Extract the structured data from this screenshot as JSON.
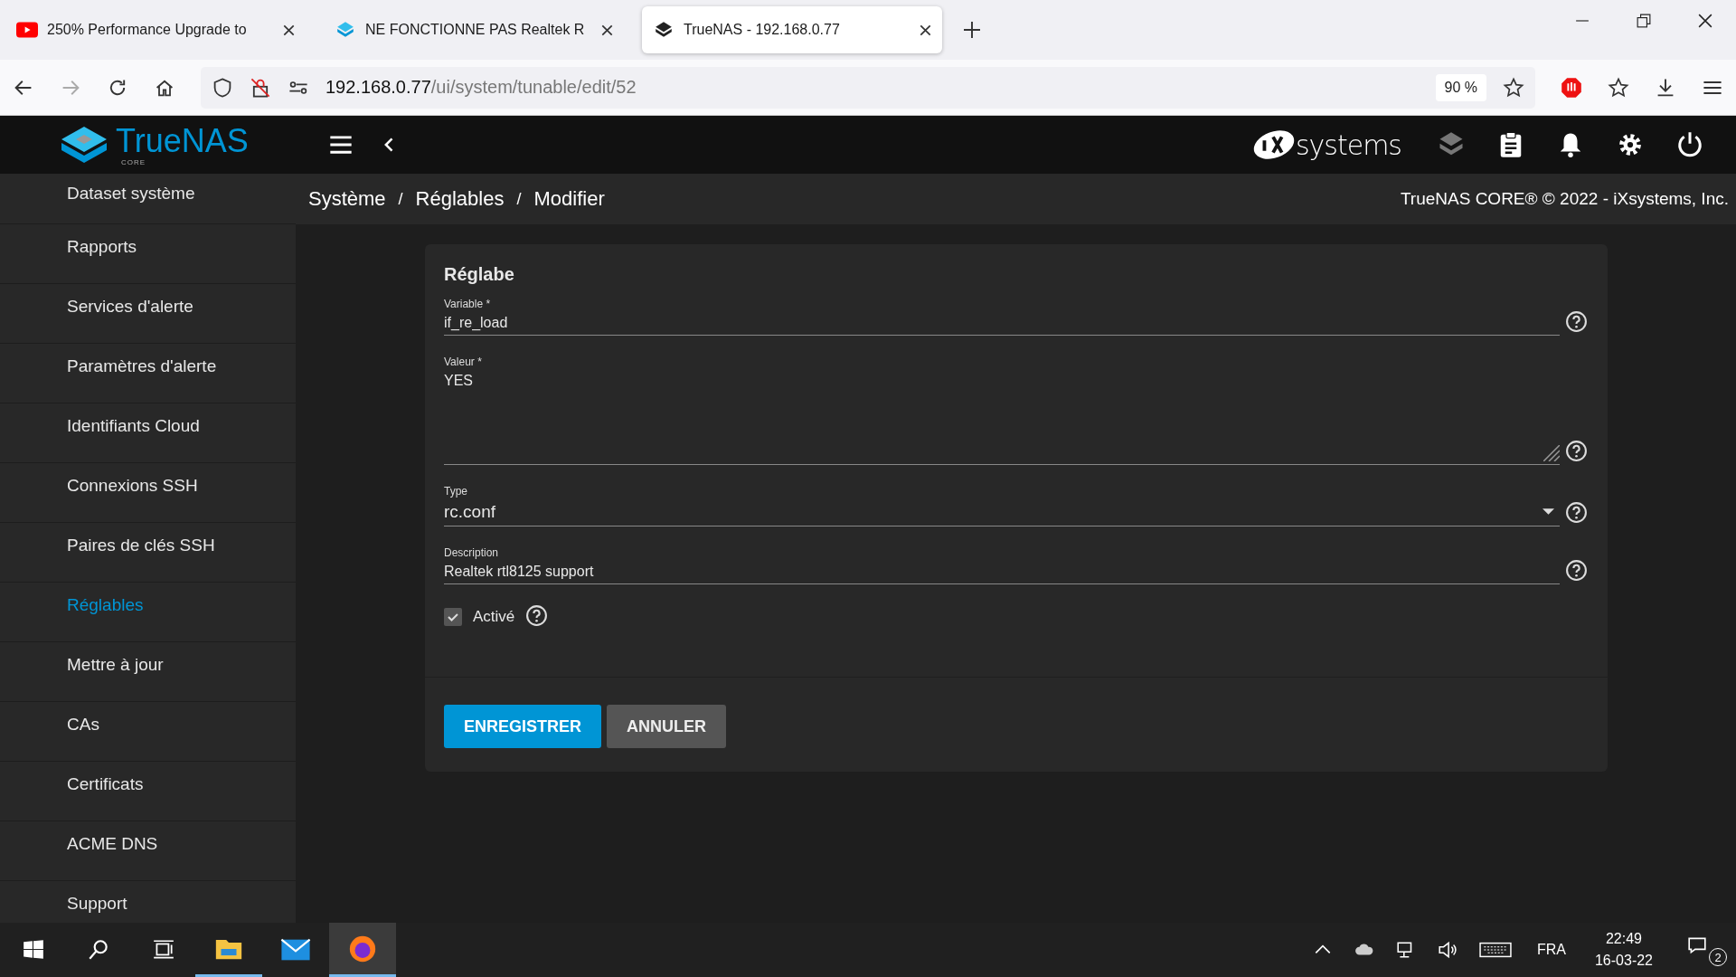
{
  "browser": {
    "tabs": [
      {
        "title": "250% Performance Upgrade to",
        "selected": false
      },
      {
        "title": "NE FONCTIONNE PAS Realtek R",
        "selected": false
      },
      {
        "title": "TrueNAS - 192.168.0.77",
        "selected": true
      }
    ],
    "url_host": "192.168.0.77",
    "url_path": "/ui/system/tunable/edit/52",
    "zoom": "90 %"
  },
  "header": {
    "logo_text": "TrueNAS",
    "logo_sub": "CORE",
    "brand": "systems"
  },
  "sidebar": {
    "items": [
      {
        "label": "Dataset système",
        "selected": false
      },
      {
        "label": "Rapports",
        "selected": false
      },
      {
        "label": "Services d'alerte",
        "selected": false
      },
      {
        "label": "Paramètres d'alerte",
        "selected": false
      },
      {
        "label": "Identifiants Cloud",
        "selected": false
      },
      {
        "label": "Connexions SSH",
        "selected": false
      },
      {
        "label": "Paires de clés SSH",
        "selected": false
      },
      {
        "label": "Réglables",
        "selected": true
      },
      {
        "label": "Mettre à jour",
        "selected": false
      },
      {
        "label": "CAs",
        "selected": false
      },
      {
        "label": "Certificats",
        "selected": false
      },
      {
        "label": "ACME DNS",
        "selected": false
      },
      {
        "label": "Support",
        "selected": false
      }
    ]
  },
  "breadcrumb": [
    {
      "kind": "link",
      "text": "Système"
    },
    {
      "kind": "separator",
      "text": "/"
    },
    {
      "kind": "link",
      "text": "Réglables"
    },
    {
      "kind": "separator",
      "text": "/"
    },
    {
      "kind": "current",
      "text": "Modifier"
    }
  ],
  "copyright": "TrueNAS CORE® © 2022 - iXsystems, Inc.",
  "form": {
    "title": "Réglabe",
    "fields": [
      {
        "kind": "text",
        "label": "Variable *",
        "value": "if_re_load"
      },
      {
        "kind": "textarea",
        "label": "Valeur *",
        "value": "YES"
      },
      {
        "kind": "select",
        "label": "Type",
        "value": "rc.conf"
      },
      {
        "kind": "text",
        "label": "Description",
        "value": "Realtek rtl8125 support"
      }
    ],
    "checkbox": {
      "label": "Activé",
      "checked": true
    },
    "buttons": [
      {
        "label": "ENREGISTRER",
        "kind": "primary"
      },
      {
        "label": "ANNULER",
        "kind": "secondary"
      }
    ]
  },
  "taskbar": {
    "language": "FRA",
    "time": "22:49",
    "date": "16-03-22",
    "notifications": "2"
  }
}
